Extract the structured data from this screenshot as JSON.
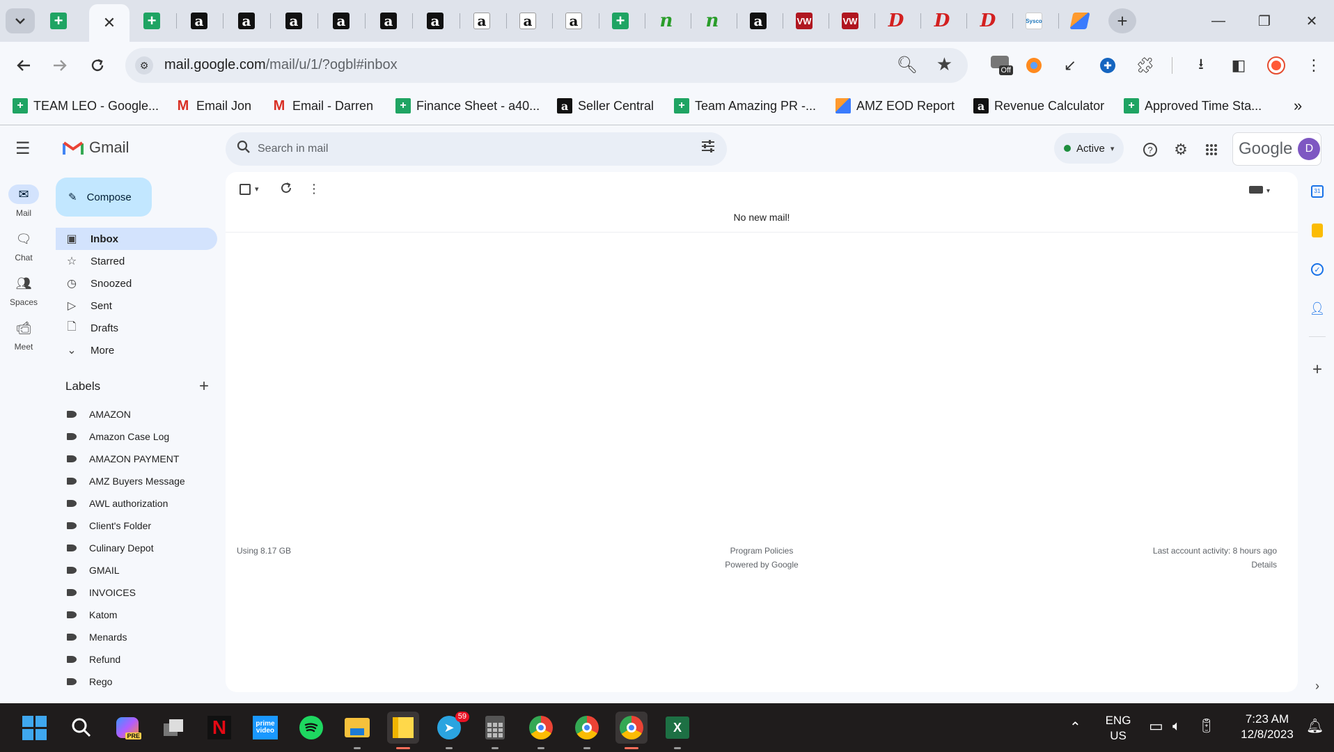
{
  "browser": {
    "address_url_host": "mail.google.com",
    "address_url_path": "/mail/u/1/?ogbl#inbox",
    "bookmarks": [
      {
        "label": "TEAM LEO - Google...",
        "icon": "sheets-icon"
      },
      {
        "label": "Email Jon",
        "icon": "gmail-icon"
      },
      {
        "label": "Email - Darren",
        "icon": "gmail-icon"
      },
      {
        "label": "Finance Sheet - a40...",
        "icon": "sheets-icon"
      },
      {
        "label": "Seller Central",
        "icon": "amazon-icon"
      },
      {
        "label": "Team Amazing PR -...",
        "icon": "sheets-icon"
      },
      {
        "label": "AMZ EOD Report",
        "icon": "eod-icon"
      },
      {
        "label": "Revenue Calculator",
        "icon": "amazon-icon"
      },
      {
        "label": "Approved Time Sta...",
        "icon": "sheets-icon"
      }
    ],
    "extension_badge": "Off"
  },
  "gmail": {
    "app_name": "Gmail",
    "search_placeholder": "Search in mail",
    "status": "Active",
    "account_brand": "Google",
    "avatar_letter": "D",
    "compose_label": "Compose",
    "rail": [
      {
        "label": "Mail"
      },
      {
        "label": "Chat"
      },
      {
        "label": "Spaces"
      },
      {
        "label": "Meet"
      }
    ],
    "nav": [
      {
        "label": "Inbox",
        "icon": "inbox-icon"
      },
      {
        "label": "Starred",
        "icon": "star-icon"
      },
      {
        "label": "Snoozed",
        "icon": "clock-icon"
      },
      {
        "label": "Sent",
        "icon": "send-icon"
      },
      {
        "label": "Drafts",
        "icon": "draft-icon"
      },
      {
        "label": "More",
        "icon": "chevron-down-icon"
      }
    ],
    "labels_heading": "Labels",
    "labels": [
      "AMAZON",
      "Amazon Case Log",
      "AMAZON PAYMENT",
      "AMZ Buyers Message",
      "AWL authorization",
      "Client's Folder",
      "Culinary Depot",
      "GMAIL",
      "INVOICES",
      "Katom",
      "Menards",
      "Refund",
      "Rego"
    ],
    "empty_message": "No new mail!",
    "footer": {
      "storage": "Using 8.17 GB",
      "policies": "Program Policies",
      "powered": "Powered by Google",
      "activity": "Last account activity: 8 hours ago",
      "details": "Details"
    }
  },
  "taskbar": {
    "telegram_badge": "59",
    "lang_line1": "ENG",
    "lang_line2": "US",
    "time": "7:23 AM",
    "date": "12/8/2023"
  }
}
